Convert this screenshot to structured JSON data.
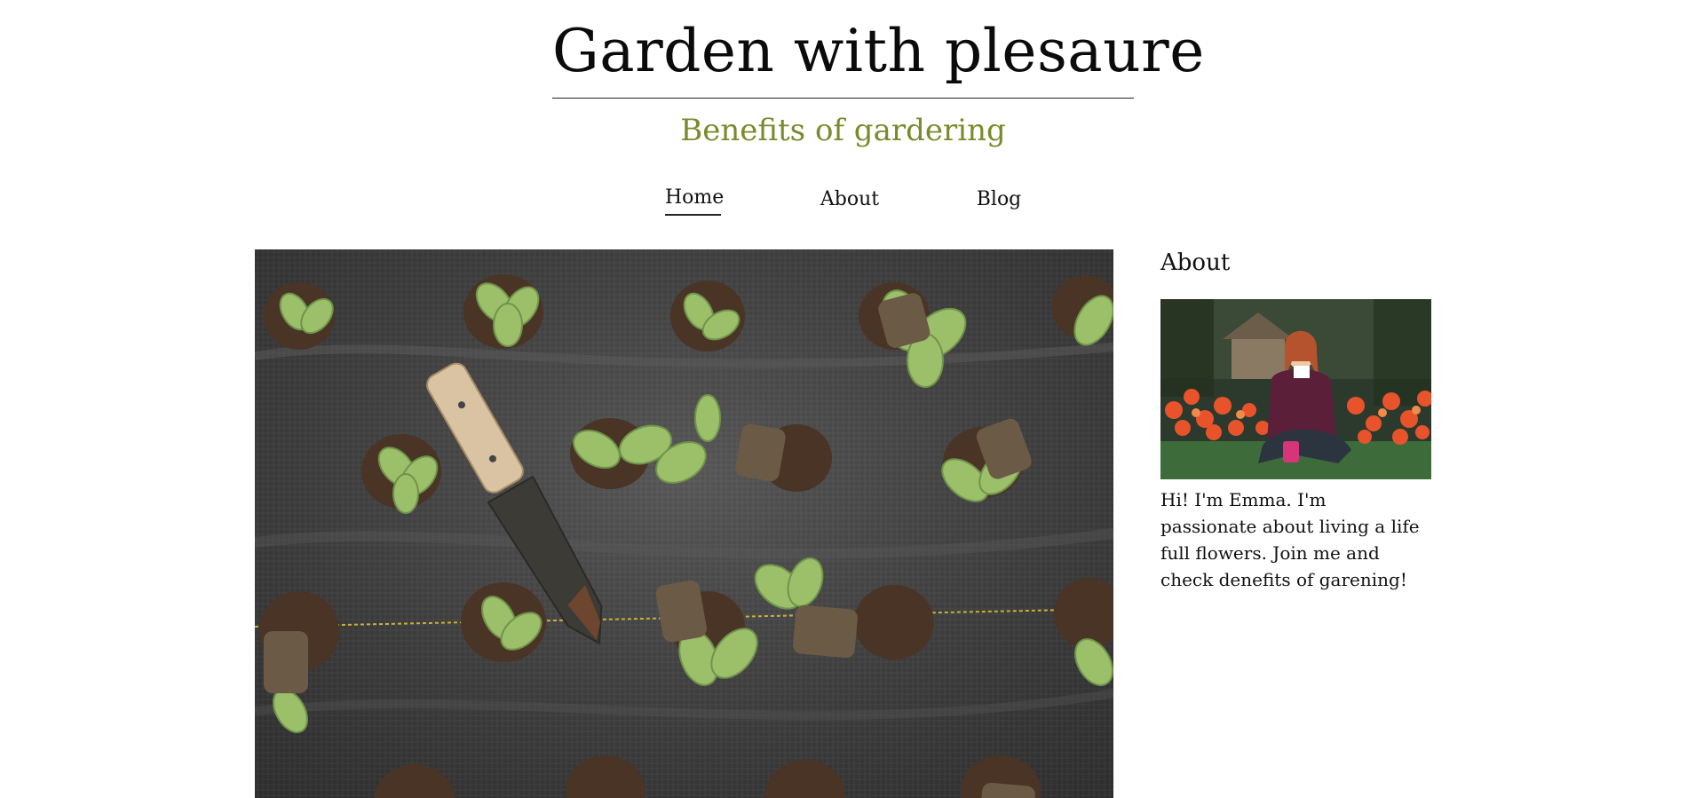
{
  "header": {
    "title": "Garden with plesaure",
    "subtitle": "Benefits of gardering"
  },
  "nav": {
    "items": [
      {
        "label": "Home",
        "active": true
      },
      {
        "label": "About",
        "active": false
      },
      {
        "label": "Blog",
        "active": false
      }
    ]
  },
  "hero": {
    "image_description_icon": "seedlings-garden-photo"
  },
  "sidebar": {
    "heading": "About",
    "bio": "Hi! I'm Emma. I'm passionate about living a life full flowers. Join me and check denefits of garening!"
  },
  "colors": {
    "subtitle": "#7a8a2b",
    "text": "#111111",
    "background": "#ffffff"
  }
}
